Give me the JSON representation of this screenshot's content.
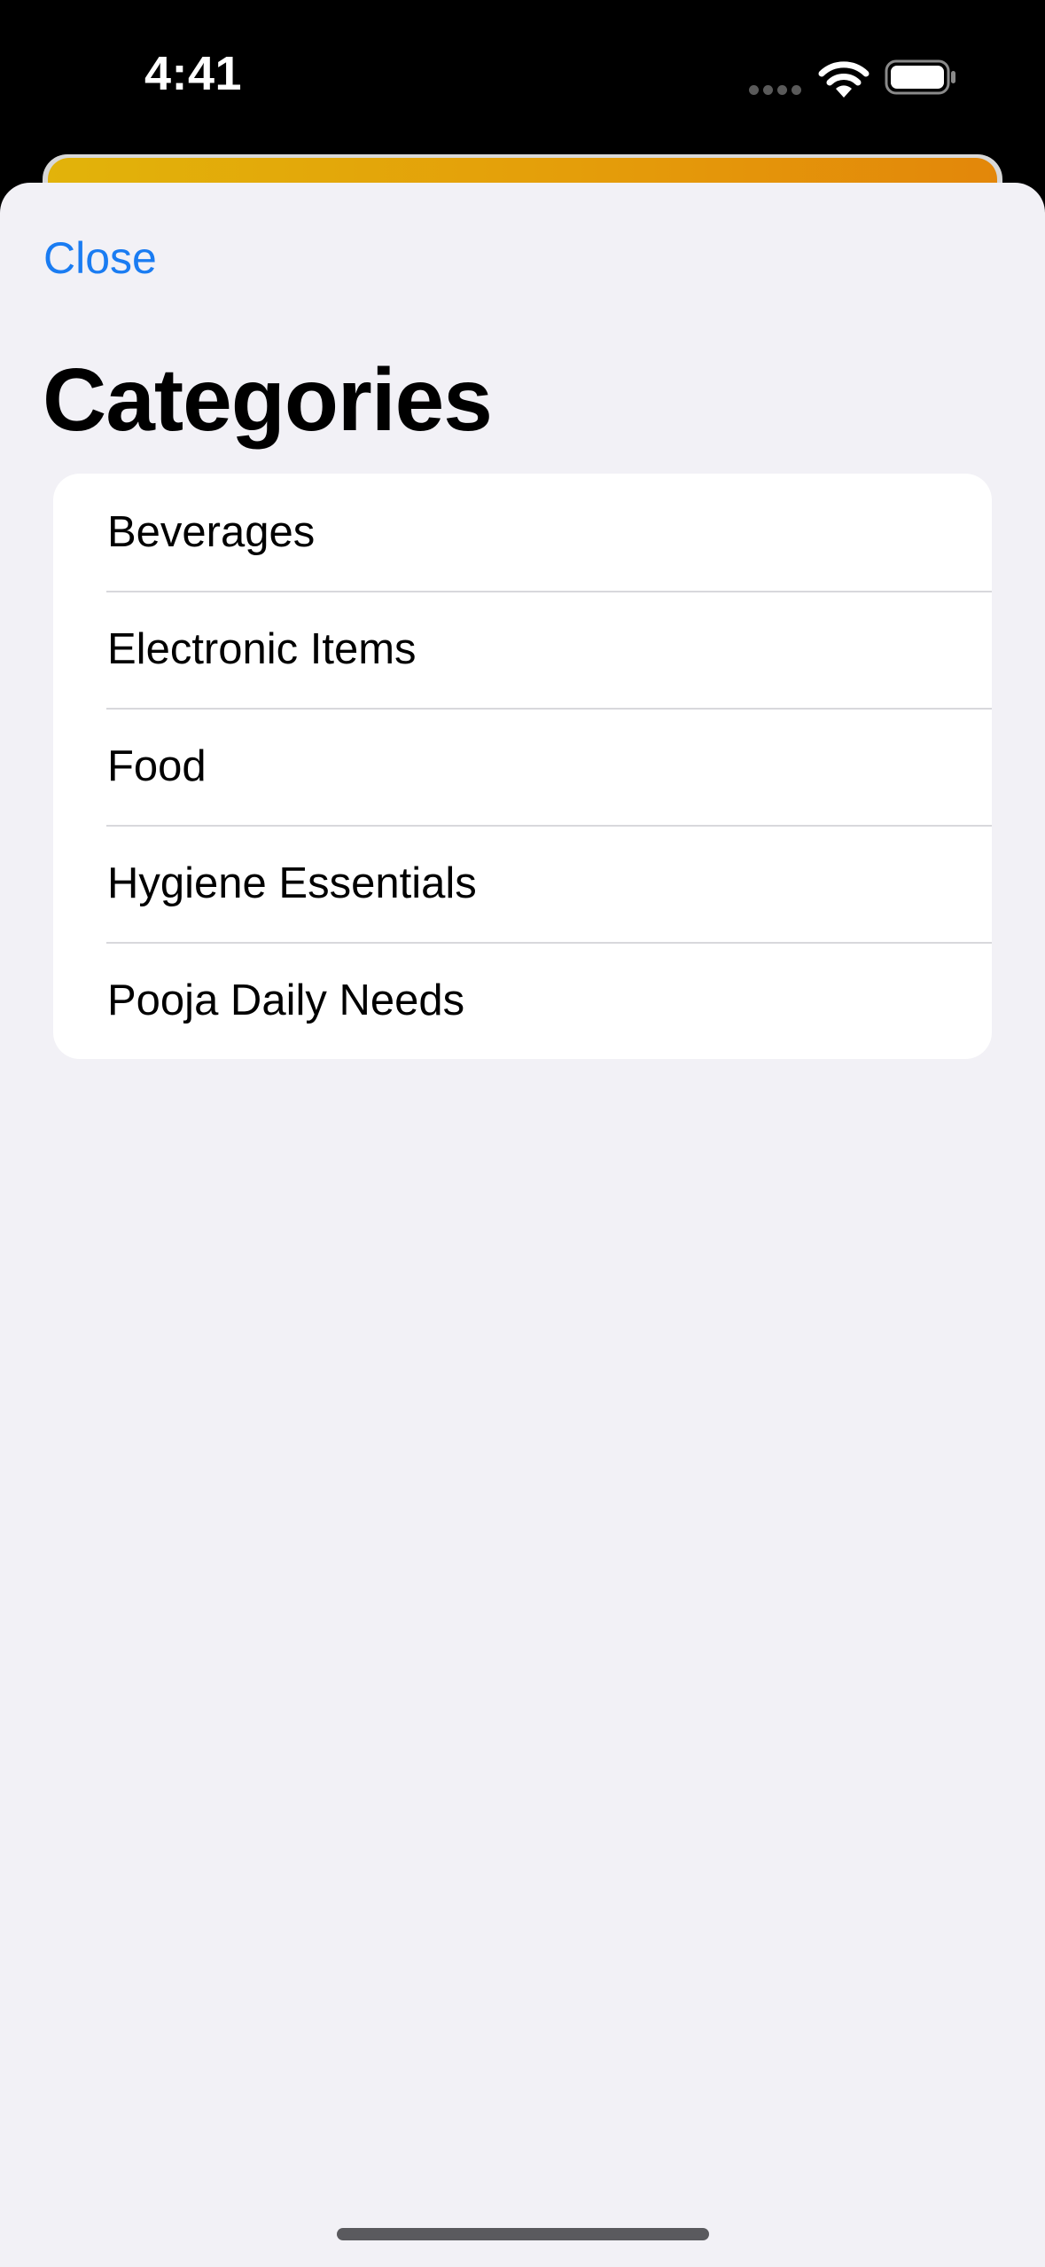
{
  "status_bar": {
    "time": "4:41",
    "icons": [
      "signal-icon",
      "wifi-icon",
      "battery-icon"
    ]
  },
  "background": {
    "banner_colors": [
      "#e2b30a",
      "#e3870a"
    ]
  },
  "sheet": {
    "close_label": "Close",
    "title": "Categories",
    "items": [
      {
        "label": "Beverages"
      },
      {
        "label": "Electronic Items"
      },
      {
        "label": "Food"
      },
      {
        "label": "Hygiene Essentials"
      },
      {
        "label": "Pooja Daily Needs"
      }
    ]
  },
  "colors": {
    "accent": "#1a7cf2",
    "sheet_background": "#f2f1f6",
    "list_background": "#ffffff",
    "separator": "#d8d8dc"
  }
}
